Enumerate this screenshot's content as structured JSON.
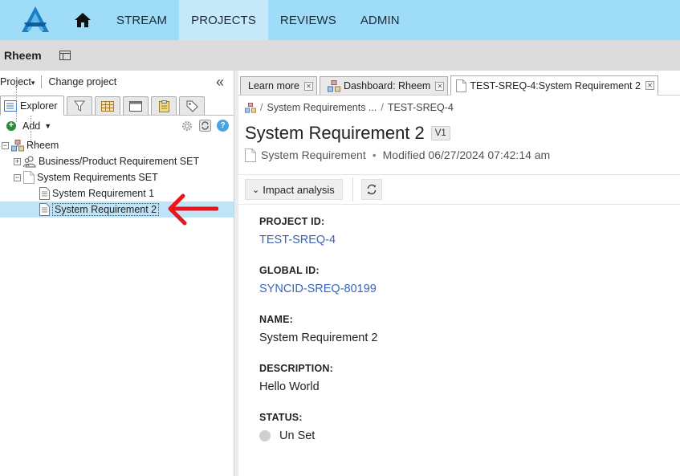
{
  "nav": {
    "items": [
      {
        "label": "STREAM",
        "active": false
      },
      {
        "label": "PROJECTS",
        "active": true
      },
      {
        "label": "REVIEWS",
        "active": false
      },
      {
        "label": "ADMIN",
        "active": false
      }
    ]
  },
  "project": {
    "name": "Rheem"
  },
  "left": {
    "project_menu": "Project",
    "change_project": "Change project",
    "explorer_tab": "Explorer",
    "add_label": "Add"
  },
  "tree": {
    "root": "Rheem",
    "item_business": "Business/Product Requirement SET",
    "item_sysreq_set": "System Requirements SET",
    "item_sr1": "System Requirement 1",
    "item_sr2": "System Requirement 2"
  },
  "tabs": {
    "learn_more": "Learn more",
    "dashboard": "Dashboard: Rheem",
    "current": "TEST-SREQ-4:System Requirement 2"
  },
  "breadcrumb": {
    "parent": "System Requirements ...",
    "current": "TEST-SREQ-4"
  },
  "item": {
    "title": "System Requirement 2",
    "version": "V1",
    "type": "System Requirement",
    "modified": "Modified 06/27/2024 07:42:14 am"
  },
  "actions": {
    "impact_analysis": "Impact analysis"
  },
  "fields": {
    "project_id_label": "PROJECT ID:",
    "project_id": "TEST-SREQ-4",
    "global_id_label": "GLOBAL ID:",
    "global_id": "SYNCID-SREQ-80199",
    "name_label": "NAME:",
    "name": "System Requirement 2",
    "description_label": "DESCRIPTION:",
    "description": "Hello World",
    "status_label": "STATUS:",
    "status": "Un Set"
  },
  "colors": {
    "nav_bg": "#9fdcf7",
    "selected_row": "#bfe3f7",
    "link": "#3a64b8",
    "annotation_arrow": "#e8161b"
  }
}
